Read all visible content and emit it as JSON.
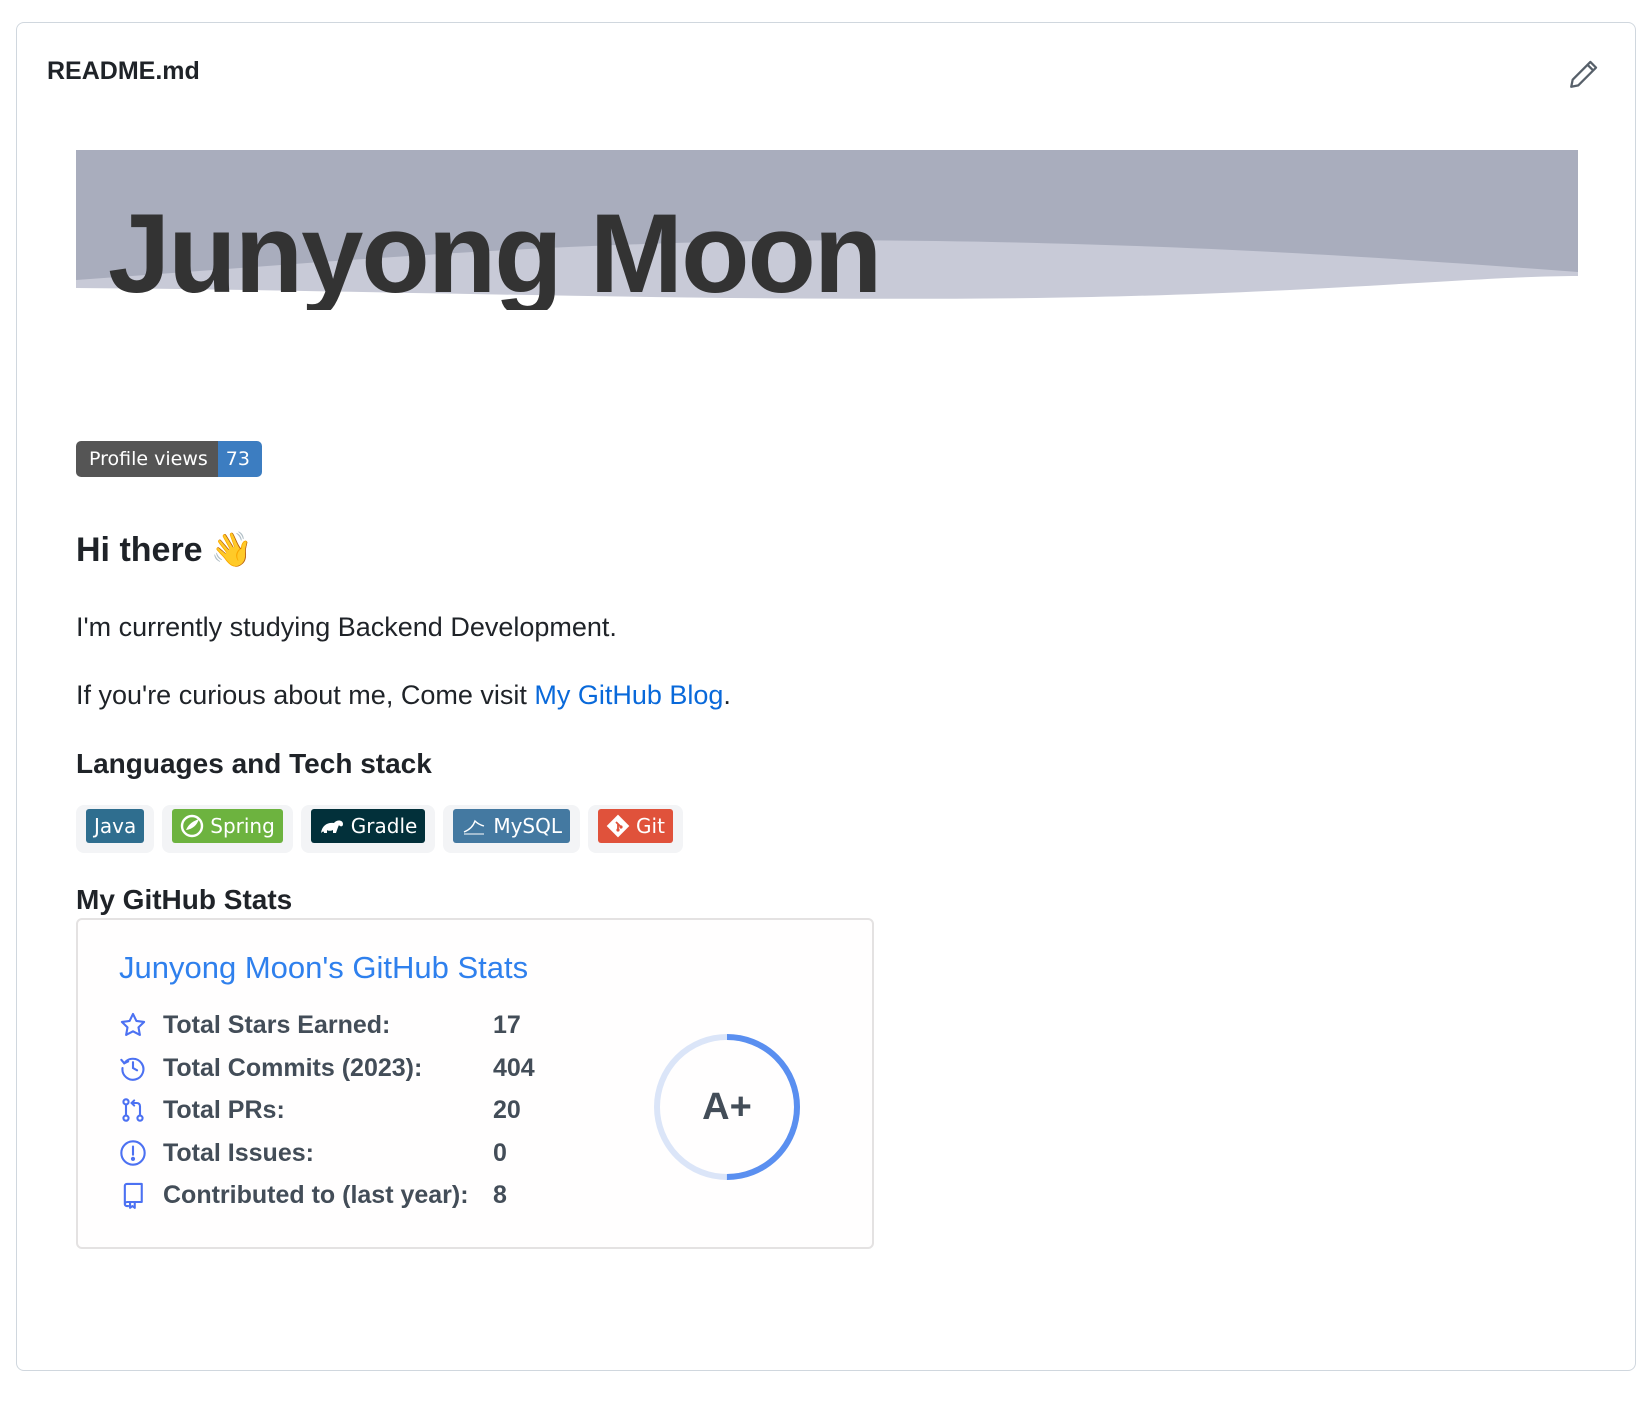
{
  "card": {
    "title": "README.md"
  },
  "banner": {
    "name": "Junyong Moon"
  },
  "profile_views": {
    "label": "Profile views",
    "count": "73"
  },
  "greeting": {
    "heading": "Hi there",
    "emoji": "👋"
  },
  "intro": {
    "line1": "I'm currently studying Backend Development.",
    "line2_prefix": "If you're curious about me, Come visit ",
    "blog_link": "My GitHub Blog",
    "line2_suffix": "."
  },
  "tech": {
    "heading": "Languages and Tech stack",
    "badges": [
      {
        "label": "Java",
        "color": "#2f6e8f",
        "icon": "java-icon"
      },
      {
        "label": "Spring",
        "color": "#6db33f",
        "icon": "spring-icon"
      },
      {
        "label": "Gradle",
        "color": "#02303a",
        "icon": "gradle-icon"
      },
      {
        "label": "MySQL",
        "color": "#4479a1",
        "icon": "mysql-icon"
      },
      {
        "label": "Git",
        "color": "#e0523b",
        "icon": "git-icon"
      }
    ]
  },
  "stats": {
    "heading": "My GitHub Stats",
    "title": "Junyong Moon's GitHub Stats",
    "rows": [
      {
        "label": "Total Stars Earned:",
        "value": "17",
        "icon": "star-icon"
      },
      {
        "label": "Total Commits (2023):",
        "value": "404",
        "icon": "history-icon"
      },
      {
        "label": "Total PRs:",
        "value": "20",
        "icon": "pull-request-icon"
      },
      {
        "label": "Total Issues:",
        "value": "0",
        "icon": "issue-icon"
      },
      {
        "label": "Contributed to (last year):",
        "value": "8",
        "icon": "repo-icon"
      }
    ],
    "rank": "A+",
    "rank_progress": 0.5,
    "accent": "#2f80ed",
    "ring_bg": "#dbe5f8",
    "ring_fg": "#5a8ff0"
  }
}
